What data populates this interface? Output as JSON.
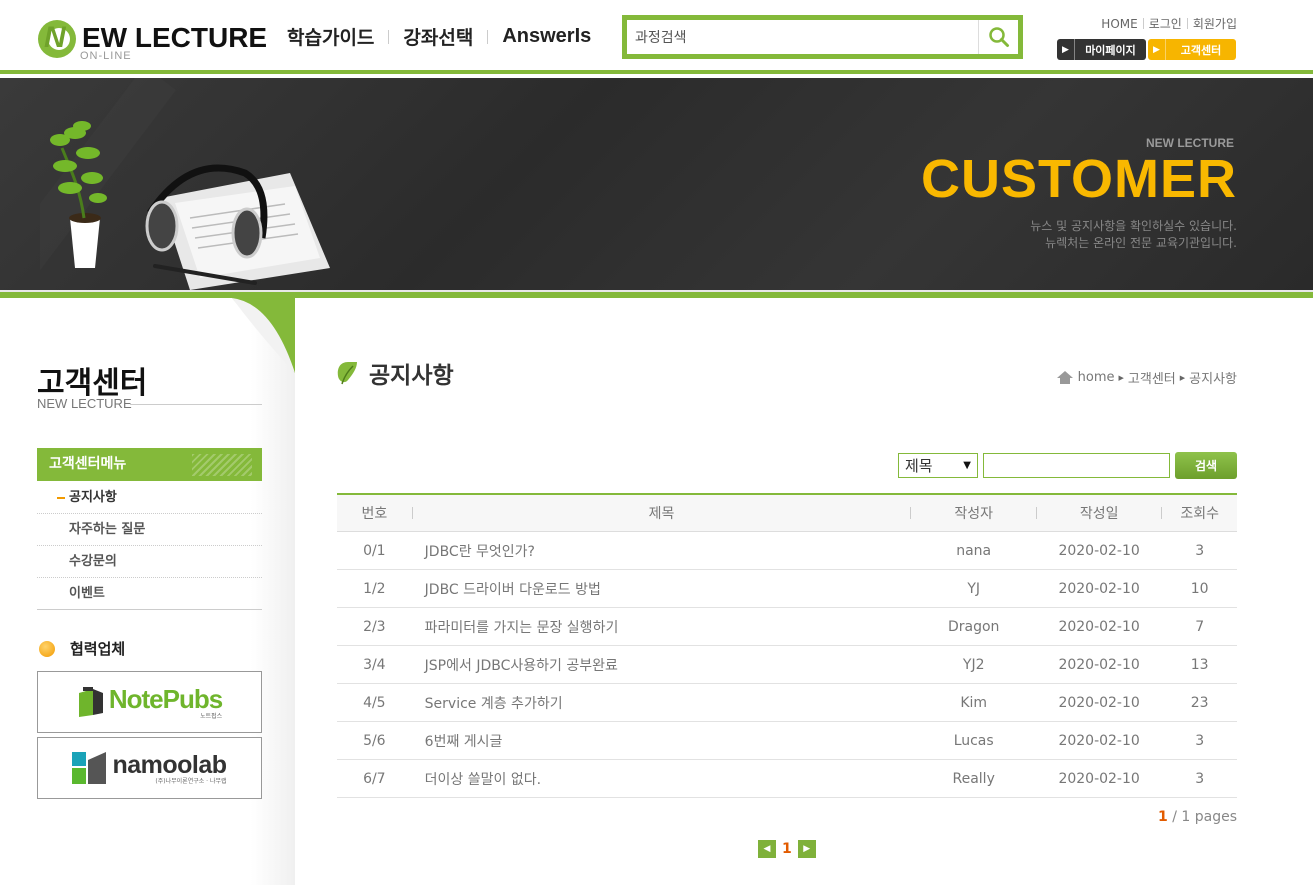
{
  "header": {
    "logo_letter": "N",
    "logo_text": "EW LECTURE",
    "logo_sub": "ON-LINE",
    "nav": [
      "학습가이드",
      "강좌선택",
      "AnswerIs"
    ],
    "search_placeholder": "과정검색",
    "top_links": [
      "HOME",
      "로그인",
      "회원가입"
    ],
    "mypage_label": "마이페이지",
    "cs_label": "고객센터"
  },
  "banner": {
    "sub": "NEW LECTURE",
    "title": "CUSTOMER",
    "desc_line1": "뉴스 및 공지사항을 확인하실수 있습니다.",
    "desc_line2": "뉴렉처는 온라인 전문 교육기관입니다."
  },
  "sidebar": {
    "title": "고객센터",
    "subtitle": "NEW LECTURE",
    "menu_head": "고객센터메뉴",
    "menu": [
      "공지사항",
      "자주하는 질문",
      "수강문의",
      "이벤트"
    ],
    "partner_title": "협력업체",
    "partner1": "NotePubs",
    "partner1_sub": "노트펍스",
    "partner2": "namoolab",
    "partner2_sub": "(주)나무이론연구소 · 나무랩"
  },
  "main": {
    "title": "공지사항",
    "breadcrumb": [
      "home",
      "고객센터",
      "공지사항"
    ],
    "search_field": "제목",
    "search_button": "검색",
    "columns": [
      "번호",
      "제목",
      "작성자",
      "작성일",
      "조회수"
    ],
    "rows": [
      {
        "no": "0/1",
        "title": "JDBC란 무엇인가?",
        "author": "nana",
        "date": "2020-02-10",
        "views": "3"
      },
      {
        "no": "1/2",
        "title": "JDBC 드라이버 다운로드 방법",
        "author": "YJ",
        "date": "2020-02-10",
        "views": "10"
      },
      {
        "no": "2/3",
        "title": "파라미터를 가지는 문장 실행하기",
        "author": "Dragon",
        "date": "2020-02-10",
        "views": "7"
      },
      {
        "no": "3/4",
        "title": "JSP에서 JDBC사용하기 공부완료",
        "author": "YJ2",
        "date": "2020-02-10",
        "views": "13"
      },
      {
        "no": "4/5",
        "title": "Service 계층 추가하기",
        "author": "Kim",
        "date": "2020-02-10",
        "views": "23"
      },
      {
        "no": "5/6",
        "title": "6번째 게시글",
        "author": "Lucas",
        "date": "2020-02-10",
        "views": "3"
      },
      {
        "no": "6/7",
        "title": "더이상 쓸말이 없다.",
        "author": "Really",
        "date": "2020-02-10",
        "views": "3"
      }
    ],
    "page_current": "1",
    "page_total_text": "/ 1 pages",
    "pager_number": "1"
  },
  "colors": {
    "accent": "#84b93a",
    "orange": "#f7b500",
    "banner_title": "#f9b800",
    "dark": "#333333"
  }
}
